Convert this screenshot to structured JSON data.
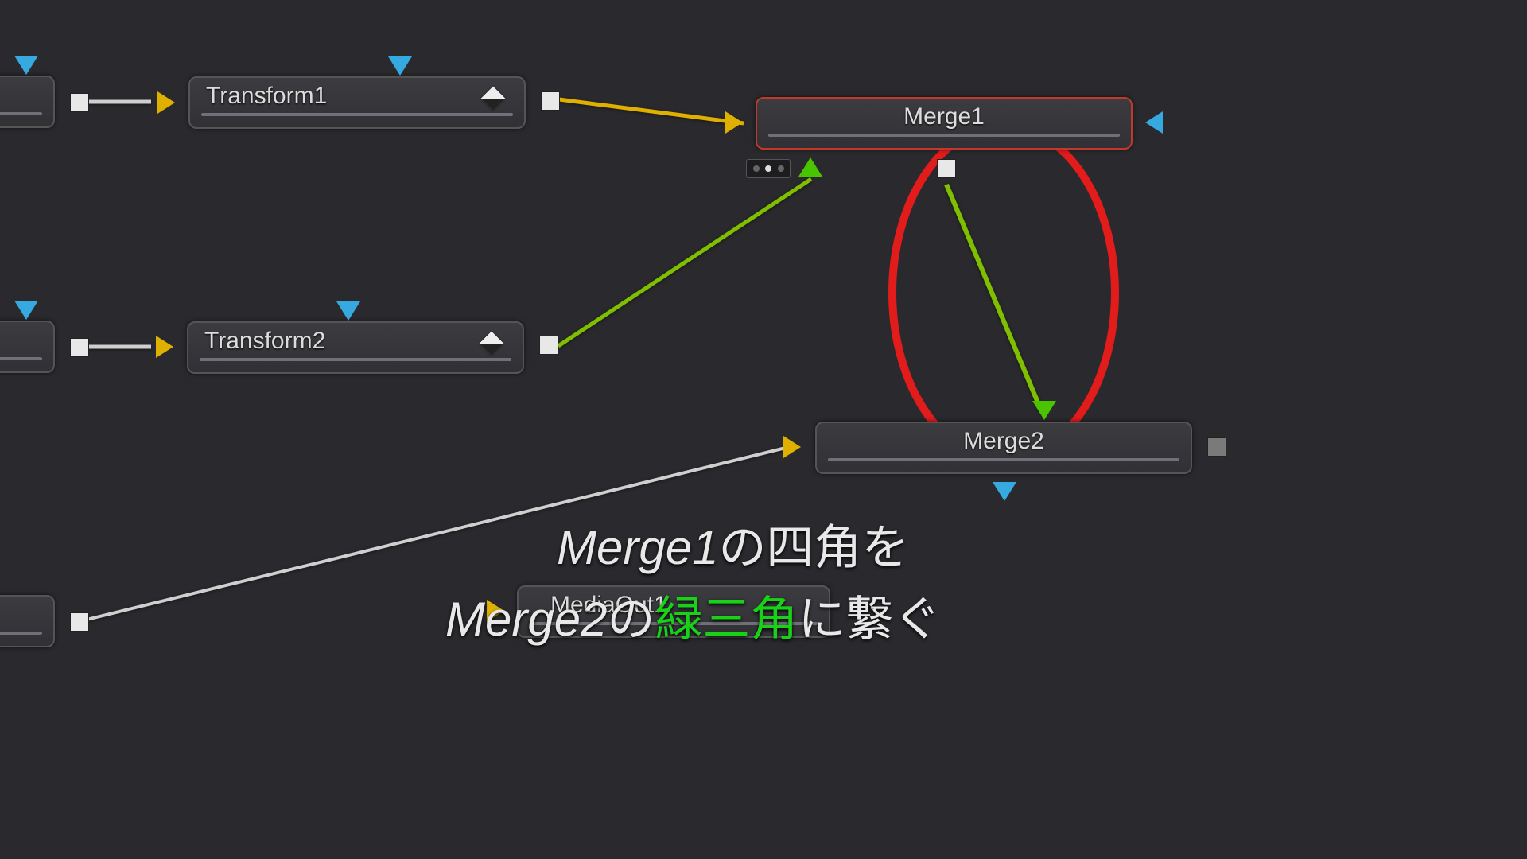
{
  "nodes": {
    "transform1": {
      "label": "Transform1"
    },
    "transform2": {
      "label": "Transform2"
    },
    "merge1": {
      "label": "Merge1"
    },
    "merge2": {
      "label": "Merge2"
    },
    "mediaout1": {
      "label": "MediaOut1"
    }
  },
  "caption": {
    "line1_italic": "Merge1",
    "line1_jp": "の四角を",
    "line2_italic": "Merge2",
    "line2_jp_a": "の",
    "line2_green": "緑三角",
    "line2_jp_b": "に繋ぐ"
  },
  "annotation": {
    "circle_color": "#e21b1b"
  },
  "wire_colors": {
    "yellow": "#e0b000",
    "green": "#7fbf00",
    "white": "#cfcfcf"
  }
}
